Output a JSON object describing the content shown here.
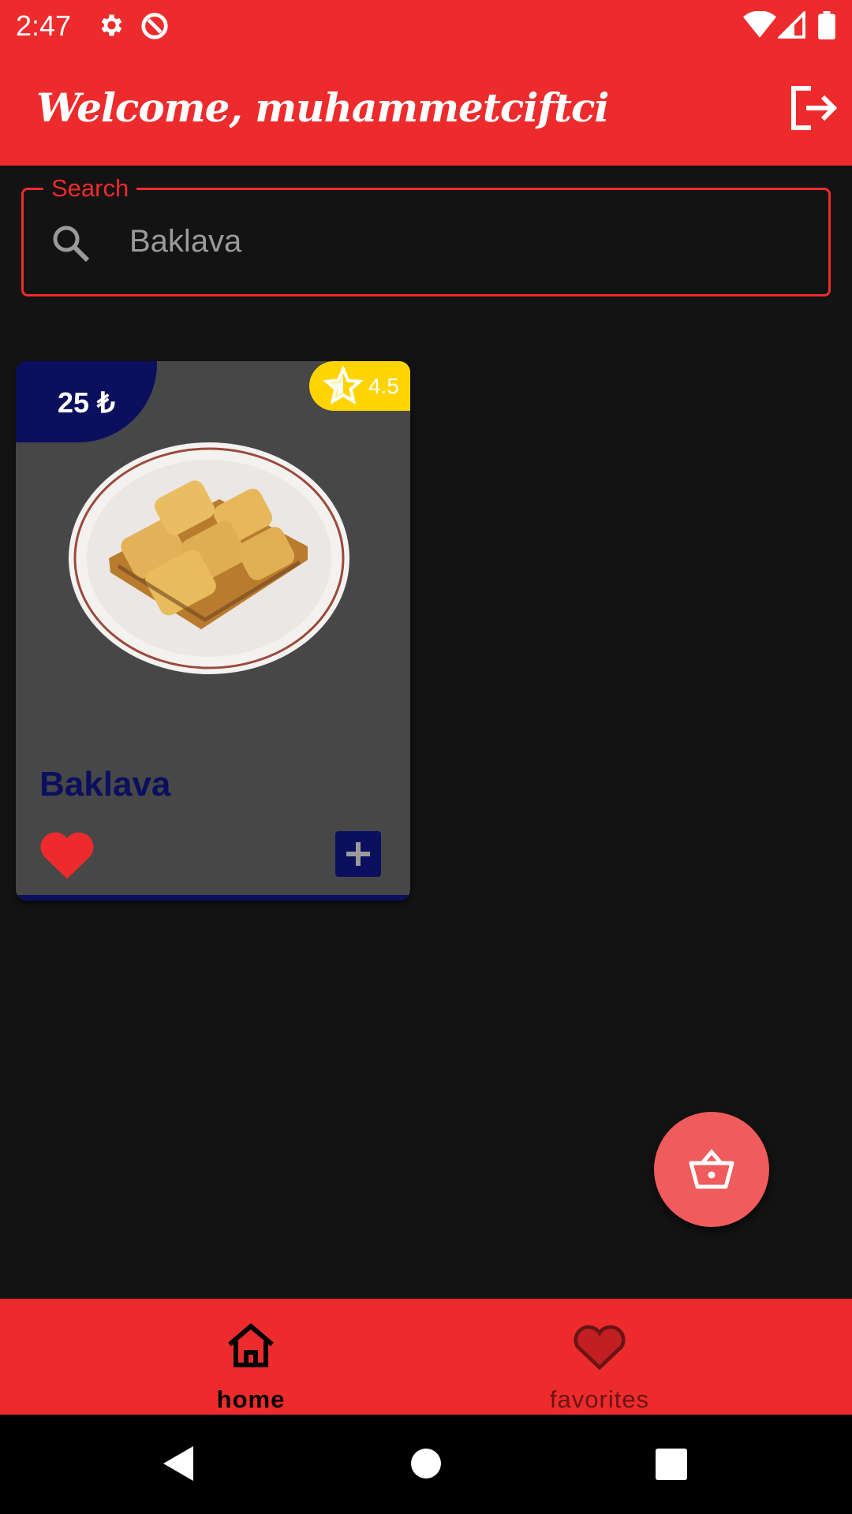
{
  "status_bar": {
    "time": "2:47",
    "icons": [
      "gear-icon",
      "at-sign-icon",
      "wifi-icon",
      "signal-icon",
      "battery-icon"
    ]
  },
  "app_bar": {
    "title": "Welcome, muhammetciftci",
    "logout_icon": "logout-icon"
  },
  "search": {
    "label": "Search",
    "value": "Baklava",
    "icon": "search-icon"
  },
  "products": [
    {
      "name": "Baklava",
      "price": "25 ₺",
      "rating": "4.5",
      "favorite": true
    }
  ],
  "fab": {
    "icon": "basket-icon"
  },
  "bottom_nav": {
    "items": [
      {
        "label": "home",
        "icon": "home-icon",
        "active": true
      },
      {
        "label": "favorites",
        "icon": "heart-icon",
        "active": false
      }
    ]
  },
  "colors": {
    "primary": "#ee2b2c",
    "navy": "#0c0f5e",
    "background": "#131313",
    "card": "#474747",
    "rating": "#ffd400",
    "fab": "#f05b5b"
  }
}
